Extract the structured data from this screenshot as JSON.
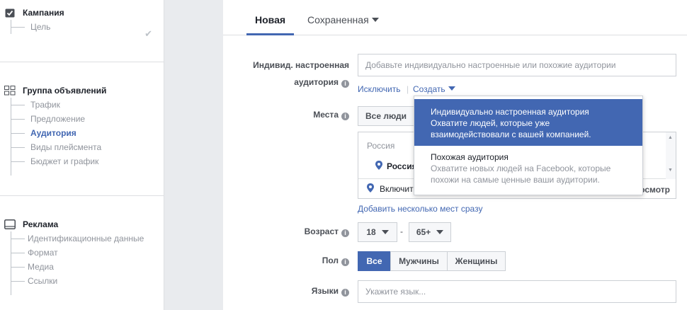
{
  "sidebar": {
    "campaign": {
      "title": "Кампания",
      "items": [
        "Цель"
      ]
    },
    "adset": {
      "title": "Группа объявлений",
      "items": [
        "Трафик",
        "Предложение",
        "Аудитория",
        "Виды плейсмента",
        "Бюджет и график"
      ],
      "active_index": 2
    },
    "ad": {
      "title": "Реклама",
      "items": [
        "Идентификационные данные",
        "Формат",
        "Медиа",
        "Ссылки"
      ]
    }
  },
  "tabs": {
    "new": "Новая",
    "saved": "Сохраненная"
  },
  "custom_audience": {
    "label_line1": "Индивид. настроенная",
    "label_line2": "аудитория",
    "placeholder": "Добавьте индивидуально настроенные или похожие аудитории",
    "exclude": "Исключить",
    "create": "Создать"
  },
  "places": {
    "label": "Места",
    "button": "Все люди",
    "list_header": "Россия",
    "list_item": "Россия",
    "include": "Включит",
    "browse_suffix": "осмотр",
    "add_many": "Добавить несколько мест сразу"
  },
  "age": {
    "label": "Возраст",
    "from": "18",
    "dash": "-",
    "to": "65+"
  },
  "gender": {
    "label": "Пол",
    "options": [
      "Все",
      "Мужчины",
      "Женщины"
    ],
    "selected": 0
  },
  "languages": {
    "label": "Языки",
    "placeholder": "Укажите язык..."
  },
  "dropdown": {
    "items": [
      {
        "title": "Индивидуально настроенная аудитория",
        "desc1": "Охватите людей, которые уже",
        "desc2": "взаимодействовали с вашей компанией."
      },
      {
        "title": "Похожая аудитория",
        "desc1": "Охватите новых людей на Facebook, которые",
        "desc2": "похожи на самые ценные ваши аудитории."
      }
    ]
  },
  "colors": {
    "accent": "#4267b2",
    "muted": "#90949c",
    "border": "#ccd0d5"
  }
}
